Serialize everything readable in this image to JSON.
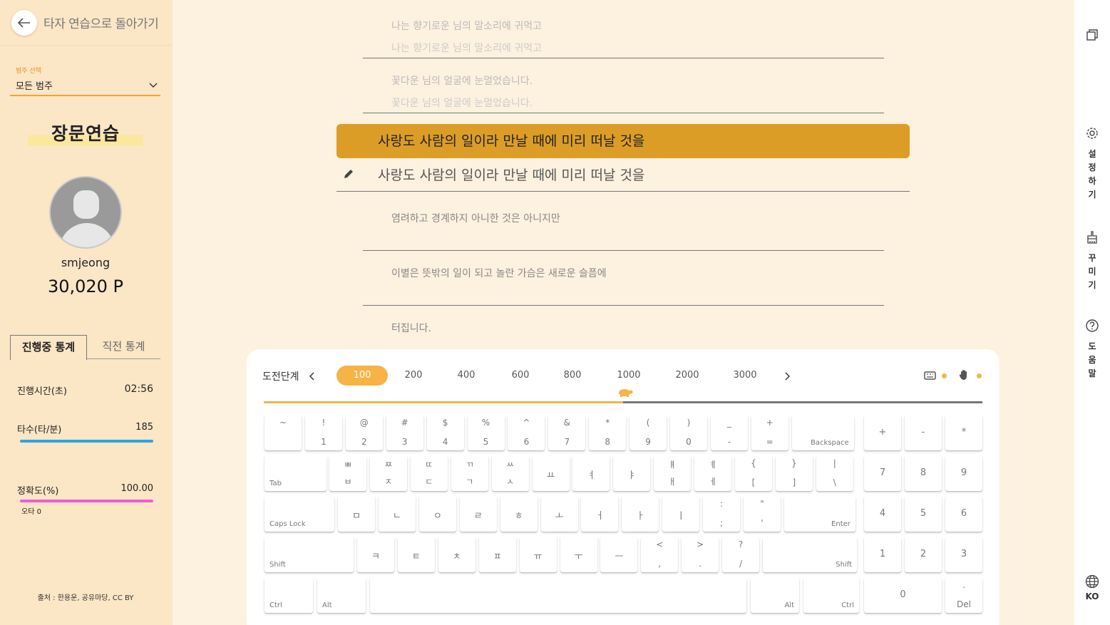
{
  "header": {
    "back_label": "타자 연습으로 돌아가기"
  },
  "category": {
    "label": "범주 선택",
    "value": "모든 범주"
  },
  "mode_title": "장문연습",
  "user": {
    "name": "smjeong",
    "points": "30,020 P"
  },
  "stat_tabs": {
    "current": "진행중 통계",
    "previous": "직전 통계"
  },
  "stats": {
    "time": {
      "label": "진행시간(초)",
      "value": "02:56"
    },
    "speed": {
      "label": "타수(타/분)",
      "value": "185",
      "bar_color": "#2aa5e6",
      "bar_fraction": 1.0
    },
    "accuracy": {
      "label": "정확도(%)",
      "value": "100.00",
      "bar_color": "#f05bd6",
      "bar_fraction": 1.0
    },
    "typo": "오타 0"
  },
  "source": "출처 : 한용운, 공유마당, CC BY",
  "lines": {
    "done1": {
      "target": "나는 향기로운 님의 말소리에 귀먹고",
      "typed": "나는 향기로운 님의 말소리에 귀먹고"
    },
    "done2": {
      "target": "꽃다운 님의 얼굴에 눈멀었습니다.",
      "typed": "꽃다운 님의 얼굴에 눈멀었습니다."
    },
    "active": {
      "target": "사랑도 사람의 일이라 만날 때에 미리 떠날 것을",
      "typed": "사랑도 사람의 일이라 만날 때에 미리 떠날 것을"
    },
    "next1": "염려하고 경계하지 아니한 것은 아니지만",
    "next2": "이별은 뜻밖의 일이 되고 놀란 가슴은 새로운 슬픔에",
    "next3": "터집니다."
  },
  "challenge": {
    "label": "도전단계",
    "stages": [
      "100",
      "200",
      "400",
      "600",
      "800",
      "1000",
      "2000",
      "3000"
    ],
    "selected": "100",
    "progress_fraction": 0.5
  },
  "accent_color": "#dc9d26",
  "keyboard": {
    "row1": [
      [
        "~",
        ""
      ],
      [
        "!",
        "1"
      ],
      [
        "@",
        "2"
      ],
      [
        "#",
        "3"
      ],
      [
        "$",
        "4"
      ],
      [
        "%",
        "5"
      ],
      [
        "^",
        "6"
      ],
      [
        "&",
        "7"
      ],
      [
        "*",
        "8"
      ],
      [
        "(",
        "9"
      ],
      [
        ")",
        "0"
      ],
      [
        "_",
        "-"
      ],
      [
        "+",
        "="
      ]
    ],
    "backspace": "Backspace",
    "tab": "Tab",
    "row2": [
      [
        "ㅃ",
        "ㅂ"
      ],
      [
        "ㅉ",
        "ㅈ"
      ],
      [
        "ㄸ",
        "ㄷ"
      ],
      [
        "ㄲ",
        "ㄱ"
      ],
      [
        "ㅆ",
        "ㅅ"
      ],
      [
        "",
        "ㅛ"
      ],
      [
        "",
        "ㅕ"
      ],
      [
        "",
        "ㅑ"
      ],
      [
        "ㅒ",
        "ㅐ"
      ],
      [
        "ㅖ",
        "ㅔ"
      ],
      [
        "{",
        "["
      ],
      [
        "}",
        "]"
      ],
      [
        "|",
        "\\"
      ]
    ],
    "caps": "Caps Lock",
    "row3": [
      [
        "",
        "ㅁ"
      ],
      [
        "",
        "ㄴ"
      ],
      [
        "",
        "ㅇ"
      ],
      [
        "",
        "ㄹ"
      ],
      [
        "",
        "ㅎ"
      ],
      [
        "",
        "ㅗ"
      ],
      [
        "",
        "ㅓ"
      ],
      [
        "",
        "ㅏ"
      ],
      [
        "",
        "ㅣ"
      ],
      [
        ":",
        ";"
      ],
      [
        "\"",
        "'"
      ]
    ],
    "enter": "Enter",
    "shift": "Shift",
    "row4": [
      [
        "",
        "ㅋ"
      ],
      [
        "",
        "ㅌ"
      ],
      [
        "",
        "ㅊ"
      ],
      [
        "",
        "ㅍ"
      ],
      [
        "",
        "ㅠ"
      ],
      [
        "",
        "ㅜ"
      ],
      [
        "",
        "ㅡ"
      ],
      [
        "<",
        ","
      ],
      [
        ">",
        "."
      ],
      [
        "?",
        "/"
      ]
    ],
    "ctrl": "Ctrl",
    "alt": "Alt",
    "numpad": {
      "top": [
        "+",
        "-",
        "*"
      ],
      "r1": [
        "7",
        "8",
        "9"
      ],
      "r2": [
        "4",
        "5",
        "6"
      ],
      "r3": [
        "1",
        "2",
        "3"
      ],
      "zero": "0",
      "del_top": ".",
      "del": "Del"
    }
  },
  "rightbar": {
    "settings": [
      "설",
      "정",
      "하",
      "기"
    ],
    "decorate": [
      "꾸",
      "미",
      "기"
    ],
    "help": [
      "도",
      "움",
      "말"
    ],
    "lang": "KO"
  }
}
